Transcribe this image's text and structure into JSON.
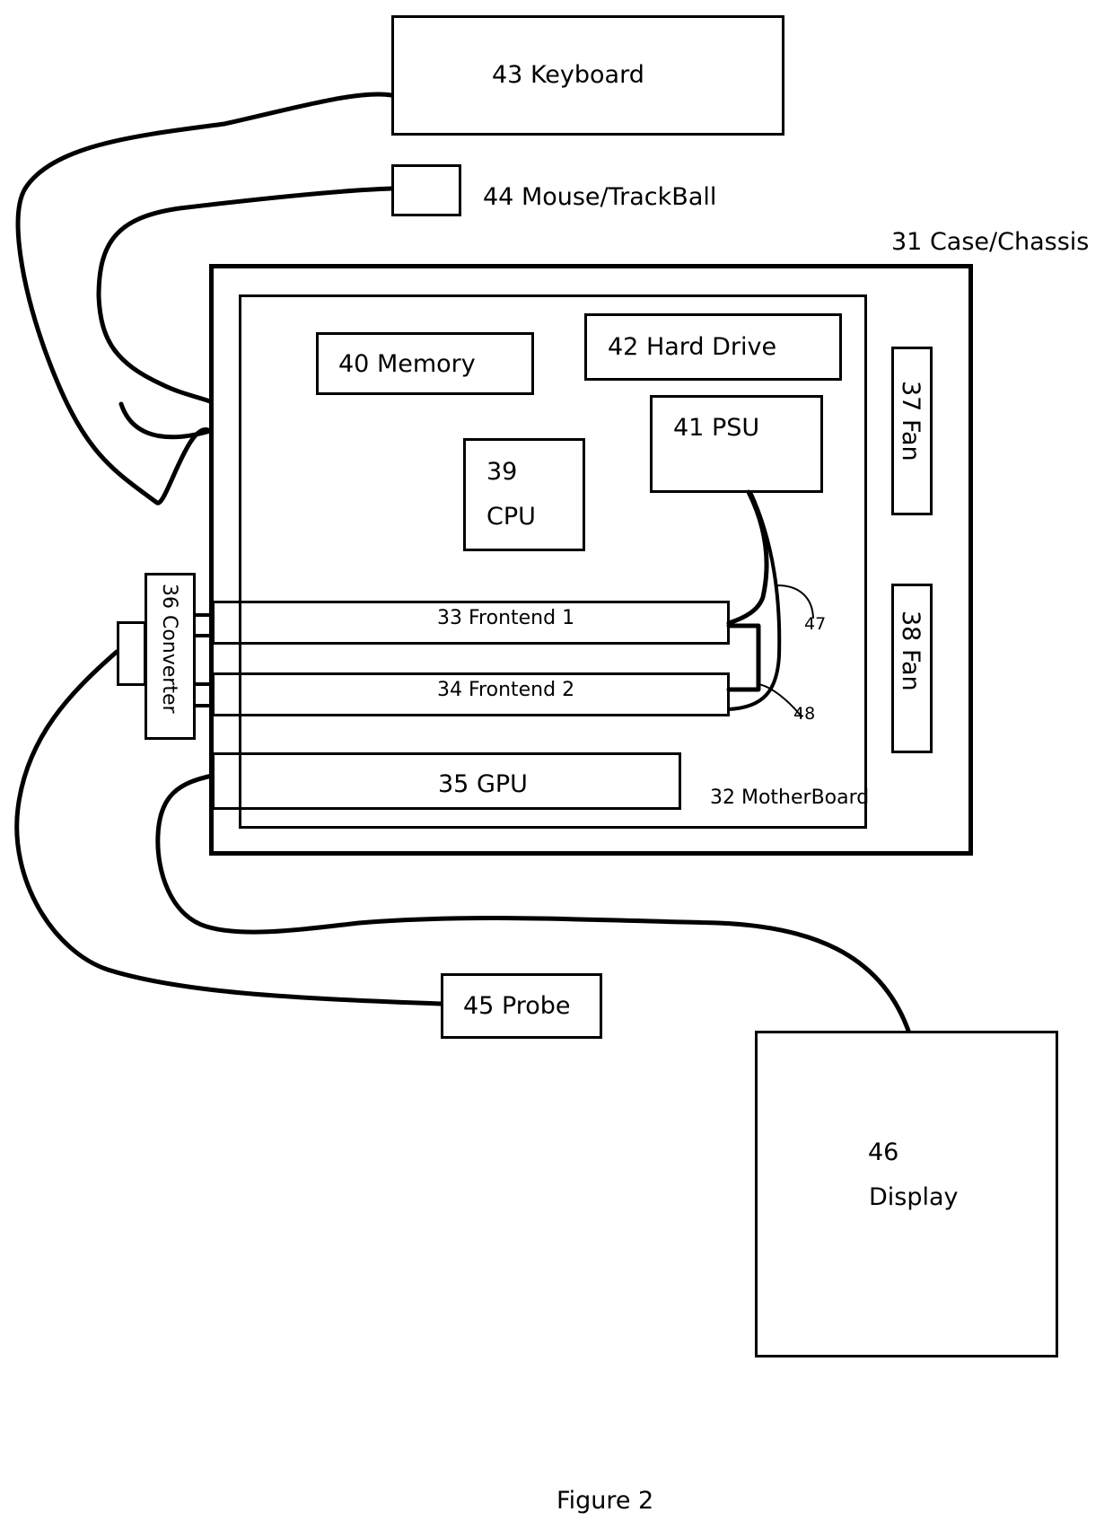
{
  "figure": {
    "caption": "Figure 2"
  },
  "components": {
    "keyboard": {
      "number": "43",
      "name": "Keyboard",
      "label": "43  Keyboard"
    },
    "mouse": {
      "number": "44",
      "name": "Mouse/TrackBall",
      "label": "44  Mouse/TrackBall"
    },
    "chassis": {
      "number": "31",
      "name": "Case/Chassis",
      "label": "31  Case/Chassis"
    },
    "motherboard": {
      "number": "32",
      "name": "MotherBoard",
      "label": "32  MotherBoard"
    },
    "memory": {
      "number": "40",
      "name": "Memory",
      "label": "40 Memory"
    },
    "hard_drive": {
      "number": "42",
      "name": "Hard Drive",
      "label": "42  Hard Drive"
    },
    "psu": {
      "number": "41",
      "name": "PSU",
      "label": "41  PSU"
    },
    "cpu": {
      "number": "39",
      "name": "CPU"
    },
    "fan_1": {
      "number": "37",
      "name": "Fan",
      "label": "37  Fan"
    },
    "fan_2": {
      "number": "38",
      "name": "Fan",
      "label": "38  Fan"
    },
    "frontend_1": {
      "number": "33",
      "name": "Frontend 1",
      "label": "33  Frontend 1"
    },
    "frontend_2": {
      "number": "34",
      "name": "Frontend 2",
      "label": "34  Frontend 2"
    },
    "gpu": {
      "number": "35",
      "name": "GPU",
      "label": "35  GPU"
    },
    "converter": {
      "number": "36",
      "name": "Converter",
      "label": "36 Converter"
    },
    "probe": {
      "number": "45",
      "name": "Probe",
      "label": "45  Probe"
    },
    "display": {
      "number": "46",
      "name": "Display"
    }
  },
  "callouts": {
    "cable_47": "47",
    "cable_48": "48"
  },
  "colors": {
    "line": "#000000",
    "background": "#ffffff"
  }
}
